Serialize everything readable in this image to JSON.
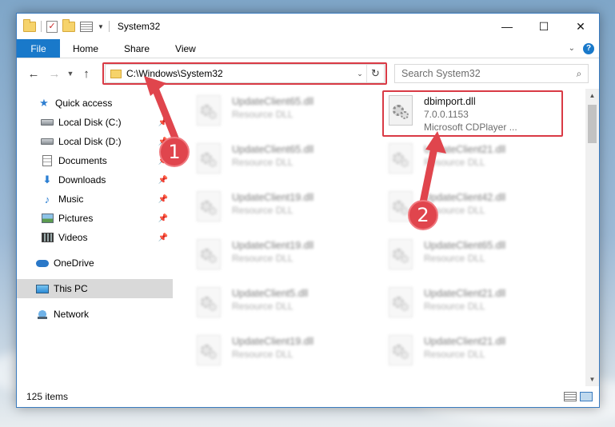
{
  "window": {
    "title": "System32",
    "controls": {
      "minimize": "—",
      "maximize": "☐",
      "close": "✕"
    }
  },
  "ribbon": {
    "tabs": [
      {
        "label": "File"
      },
      {
        "label": "Home"
      },
      {
        "label": "Share"
      },
      {
        "label": "View"
      }
    ],
    "help": "?"
  },
  "address_bar": {
    "path": "C:\\Windows\\System32"
  },
  "search": {
    "placeholder": "Search System32"
  },
  "sidebar": {
    "quick_access": "Quick access",
    "items": [
      {
        "label": "Local Disk (C:)",
        "icon": "disk-icon"
      },
      {
        "label": "Local Disk (D:)",
        "icon": "disk-icon"
      },
      {
        "label": "Documents",
        "icon": "documents-icon"
      },
      {
        "label": "Downloads",
        "icon": "downloads-icon"
      },
      {
        "label": "Music",
        "icon": "music-icon"
      },
      {
        "label": "Pictures",
        "icon": "pictures-icon"
      },
      {
        "label": "Videos",
        "icon": "videos-icon"
      }
    ],
    "onedrive": "OneDrive",
    "this_pc": "This PC",
    "network": "Network"
  },
  "files": {
    "highlighted": {
      "name": "dbimport.dll",
      "version": "7.0.0.1153",
      "description": "Microsoft CDPlayer ..."
    },
    "left_column": [
      {
        "name": "UpdateClient65.dll",
        "desc": "Resource DLL"
      },
      {
        "name": "UpdateClient65.dll",
        "desc": "Resource DLL"
      },
      {
        "name": "UpdateClient19.dll",
        "desc": "Resource DLL"
      },
      {
        "name": "UpdateClient19.dll",
        "desc": "Resource DLL"
      },
      {
        "name": "UpdateClient5.dll",
        "desc": "Resource DLL"
      },
      {
        "name": "UpdateClient19.dll",
        "desc": "Resource DLL"
      }
    ],
    "right_column": [
      {
        "name": "UpdateClient21.dll",
        "desc": "Resource DLL"
      },
      {
        "name": "UpdateClient42.dll",
        "desc": "Resource DLL"
      },
      {
        "name": "UpdateClient65.dll",
        "desc": "Resource DLL"
      },
      {
        "name": "UpdateClient21.dll",
        "desc": "Resource DLL"
      },
      {
        "name": "UpdateClient21.dll",
        "desc": "Resource DLL"
      }
    ]
  },
  "status": {
    "item_count": "125 items"
  },
  "annotations": {
    "step1": "1",
    "step2": "2"
  }
}
